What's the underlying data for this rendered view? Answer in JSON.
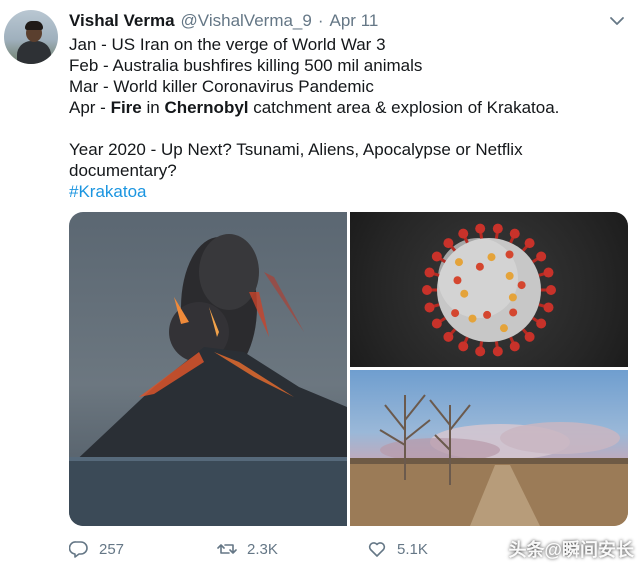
{
  "tweet": {
    "author_name": "Vishal Verma",
    "author_handle": "@VishalVerma_9",
    "separator": "·",
    "date": "Apr 11",
    "lines": {
      "jan": "Jan - US Iran on the verge of World War 3",
      "feb": "Feb - Australia bushfires killing 500 mil animals",
      "mar": "Mar - World killer Coronavirus Pandemic",
      "apr_prefix": "Apr - ",
      "apr_fire": "Fire",
      "apr_mid": " in ",
      "apr_chernobyl": "Chernobyl",
      "apr_suffix": " catchment area & explosion of Krakatoa.",
      "year": "Year 2020 - Up Next? Tsunami, Aliens, Apocalypse or Netflix documentary?"
    },
    "hashtag": "#Krakatoa"
  },
  "media": {
    "images": [
      "volcano eruption",
      "coronavirus",
      "bushfire smoke over field"
    ]
  },
  "actions": {
    "reply_count": "257",
    "retweet_count": "2.3K",
    "like_count": "5.1K"
  },
  "icons": {
    "chevron": "chevron-down-icon",
    "reply": "reply-icon",
    "retweet": "retweet-icon",
    "like": "heart-icon"
  },
  "colors": {
    "text": "#14171a",
    "secondary": "#657786",
    "link": "#1b95e0"
  },
  "watermark": "头条@瞬间安长"
}
